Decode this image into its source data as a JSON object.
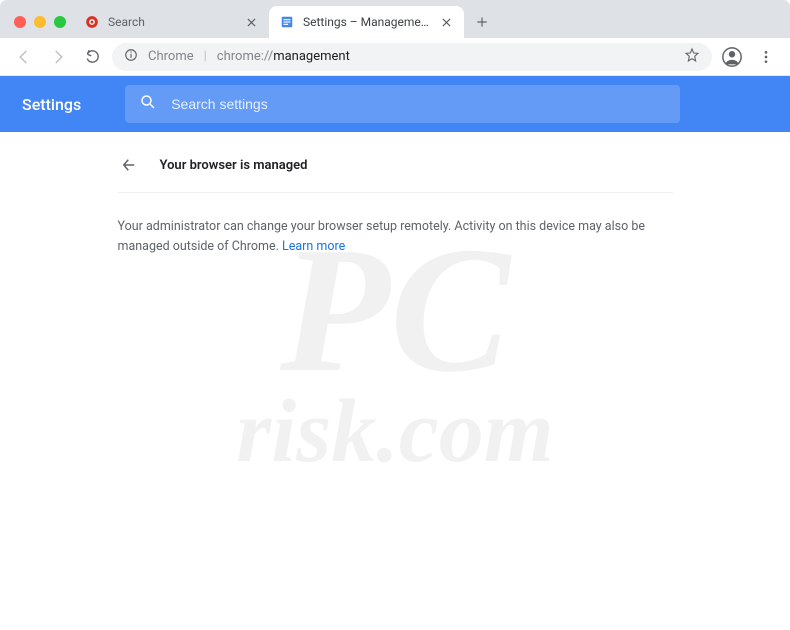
{
  "tabs": [
    {
      "title": "Search",
      "active": false
    },
    {
      "title": "Settings – Management",
      "active": true
    }
  ],
  "omnibox": {
    "label": "Chrome",
    "prefix": "chrome://",
    "path": "management"
  },
  "settings": {
    "title": "Settings",
    "search_placeholder": "Search settings"
  },
  "page": {
    "title": "Your browser is managed",
    "body": "Your administrator can change your browser setup remotely. Activity on this device may also be managed outside of Chrome. ",
    "learn_more": "Learn more"
  },
  "watermark": {
    "line1": "PC",
    "line2": "risk.com"
  }
}
